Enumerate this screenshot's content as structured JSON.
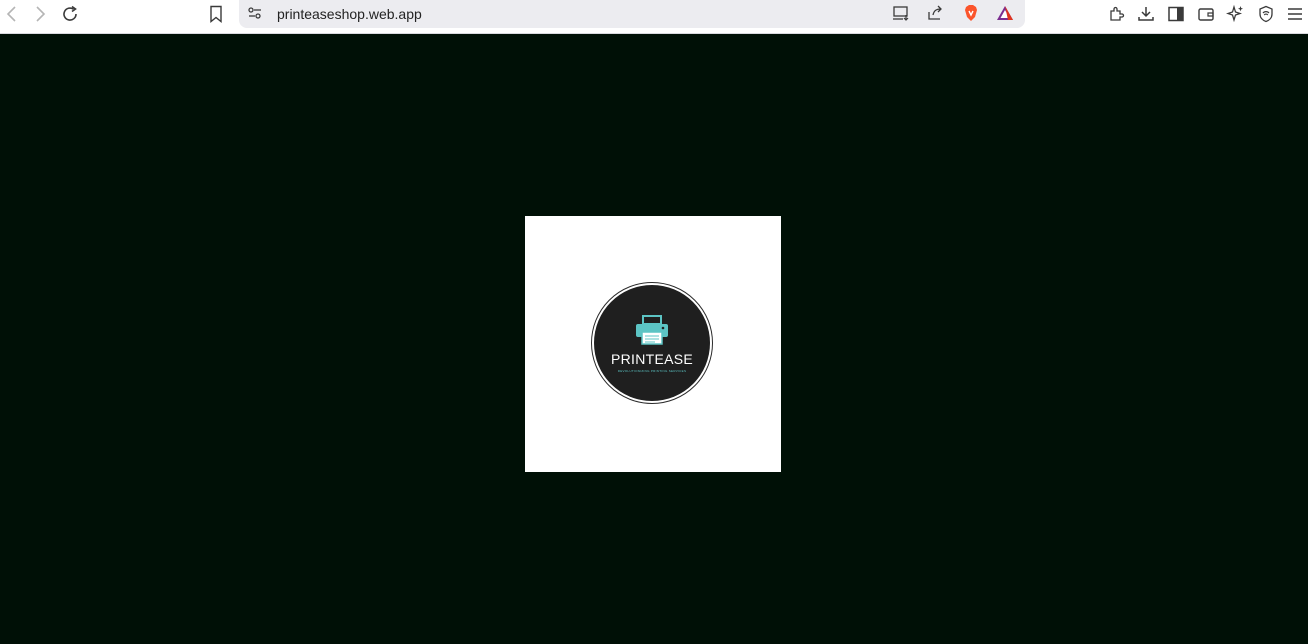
{
  "browser": {
    "url": "printeaseshop.web.app",
    "icons": [
      "back-icon",
      "forward-icon",
      "reload-icon",
      "bookmark-icon",
      "site-settings-icon",
      "install-app-icon",
      "share-icon",
      "brave-shields-icon",
      "brave-rewards-icon",
      "extensions-icon",
      "downloads-icon",
      "sidebar-icon",
      "wallet-icon",
      "leo-ai-icon",
      "vpn-icon",
      "menu-icon"
    ]
  },
  "splash": {
    "logo_name": "PRINTEASE",
    "logo_tagline": "REVOLUTIONIZING PRINTING SERVICES",
    "colors": {
      "background": "#001006",
      "card": "#ffffff",
      "disc": "#1f1f1f",
      "accent": "#5cc4c4"
    }
  }
}
